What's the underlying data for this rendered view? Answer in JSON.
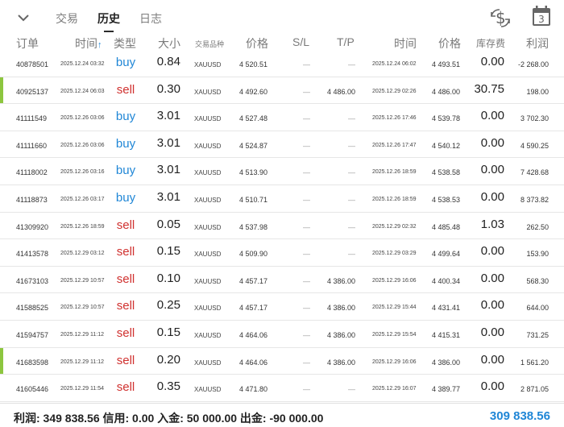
{
  "tabs": [
    {
      "label": "交易"
    },
    {
      "label": "历史"
    },
    {
      "label": "日志"
    }
  ],
  "calendar_badge": "3",
  "columns": {
    "order": "订单",
    "time": "时间",
    "sort_arrow": "↑",
    "type": "类型",
    "volume": "大小",
    "symbol": "交易品种",
    "price": "价格",
    "sl": "S/L",
    "tp": "T/P",
    "close_time": "时间",
    "close_price": "价格",
    "swap": "库存费",
    "profit": "利润"
  },
  "rows": [
    {
      "order": "40878501",
      "time": "2025.12.24 03:32",
      "type": "buy",
      "volume": "0.84",
      "symbol": "XAUUSD",
      "price": "4 520.51",
      "sl": "—",
      "tp": "—",
      "close_time": "2025.12.24 06:02",
      "close_price": "4 493.51",
      "swap": "0.00",
      "profit": "-2 268.00",
      "marker": false
    },
    {
      "order": "40925137",
      "time": "2025.12.24 06:03",
      "type": "sell",
      "volume": "0.30",
      "symbol": "XAUUSD",
      "price": "4 492.60",
      "sl": "—",
      "tp": "4 486.00",
      "close_time": "2025.12.29 02:26",
      "close_price": "4 486.00",
      "swap": "30.75",
      "profit": "198.00",
      "marker": true
    },
    {
      "order": "41111549",
      "time": "2025.12.26 03:06",
      "type": "buy",
      "volume": "3.01",
      "symbol": "XAUUSD",
      "price": "4 527.48",
      "sl": "—",
      "tp": "—",
      "close_time": "2025.12.26 17:46",
      "close_price": "4 539.78",
      "swap": "0.00",
      "profit": "3 702.30",
      "marker": false
    },
    {
      "order": "41111660",
      "time": "2025.12.26 03:06",
      "type": "buy",
      "volume": "3.01",
      "symbol": "XAUUSD",
      "price": "4 524.87",
      "sl": "—",
      "tp": "—",
      "close_time": "2025.12.26 17:47",
      "close_price": "4 540.12",
      "swap": "0.00",
      "profit": "4 590.25",
      "marker": false
    },
    {
      "order": "41118002",
      "time": "2025.12.26 03:16",
      "type": "buy",
      "volume": "3.01",
      "symbol": "XAUUSD",
      "price": "4 513.90",
      "sl": "—",
      "tp": "—",
      "close_time": "2025.12.26 18:59",
      "close_price": "4 538.58",
      "swap": "0.00",
      "profit": "7 428.68",
      "marker": false
    },
    {
      "order": "41118873",
      "time": "2025.12.26 03:17",
      "type": "buy",
      "volume": "3.01",
      "symbol": "XAUUSD",
      "price": "4 510.71",
      "sl": "—",
      "tp": "—",
      "close_time": "2025.12.26 18:59",
      "close_price": "4 538.53",
      "swap": "0.00",
      "profit": "8 373.82",
      "marker": false
    },
    {
      "order": "41309920",
      "time": "2025.12.26 18:59",
      "type": "sell",
      "volume": "0.05",
      "symbol": "XAUUSD",
      "price": "4 537.98",
      "sl": "—",
      "tp": "—",
      "close_time": "2025.12.29 02:32",
      "close_price": "4 485.48",
      "swap": "1.03",
      "profit": "262.50",
      "marker": false
    },
    {
      "order": "41413578",
      "time": "2025.12.29 03:12",
      "type": "sell",
      "volume": "0.15",
      "symbol": "XAUUSD",
      "price": "4 509.90",
      "sl": "—",
      "tp": "—",
      "close_time": "2025.12.29 03:29",
      "close_price": "4 499.64",
      "swap": "0.00",
      "profit": "153.90",
      "marker": false
    },
    {
      "order": "41673103",
      "time": "2025.12.29 10:57",
      "type": "sell",
      "volume": "0.10",
      "symbol": "XAUUSD",
      "price": "4 457.17",
      "sl": "—",
      "tp": "4 386.00",
      "close_time": "2025.12.29 16:06",
      "close_price": "4 400.34",
      "swap": "0.00",
      "profit": "568.30",
      "marker": false
    },
    {
      "order": "41588525",
      "time": "2025.12.29 10:57",
      "type": "sell",
      "volume": "0.25",
      "symbol": "XAUUSD",
      "price": "4 457.17",
      "sl": "—",
      "tp": "4 386.00",
      "close_time": "2025.12.29 15:44",
      "close_price": "4 431.41",
      "swap": "0.00",
      "profit": "644.00",
      "marker": false
    },
    {
      "order": "41594757",
      "time": "2025.12.29 11:12",
      "type": "sell",
      "volume": "0.15",
      "symbol": "XAUUSD",
      "price": "4 464.06",
      "sl": "—",
      "tp": "4 386.00",
      "close_time": "2025.12.29 15:54",
      "close_price": "4 415.31",
      "swap": "0.00",
      "profit": "731.25",
      "marker": false
    },
    {
      "order": "41683598",
      "time": "2025.12.29 11:12",
      "type": "sell",
      "volume": "0.20",
      "symbol": "XAUUSD",
      "price": "4 464.06",
      "sl": "—",
      "tp": "4 386.00",
      "close_time": "2025.12.29 16:06",
      "close_price": "4 386.00",
      "swap": "0.00",
      "profit": "1 561.20",
      "marker": true
    },
    {
      "order": "41605446",
      "time": "2025.12.29 11:54",
      "type": "sell",
      "volume": "0.35",
      "symbol": "XAUUSD",
      "price": "4 471.80",
      "sl": "—",
      "tp": "—",
      "close_time": "2025.12.29 16:07",
      "close_price": "4 389.77",
      "swap": "0.00",
      "profit": "2 871.05",
      "marker": false
    }
  ],
  "footer": {
    "summary": "利润: 349 838.56  信用: 0.00  入金: 50 000.00  出金: -90 000.00",
    "total": "309 838.56"
  },
  "colors": {
    "buy": "#1f86d6",
    "sell": "#d0312f",
    "marker": "#8dc63f",
    "total": "#1f86d6"
  },
  "icons": [
    "chevron-down-icon",
    "dollar-exchange-icon",
    "calendar-icon"
  ]
}
